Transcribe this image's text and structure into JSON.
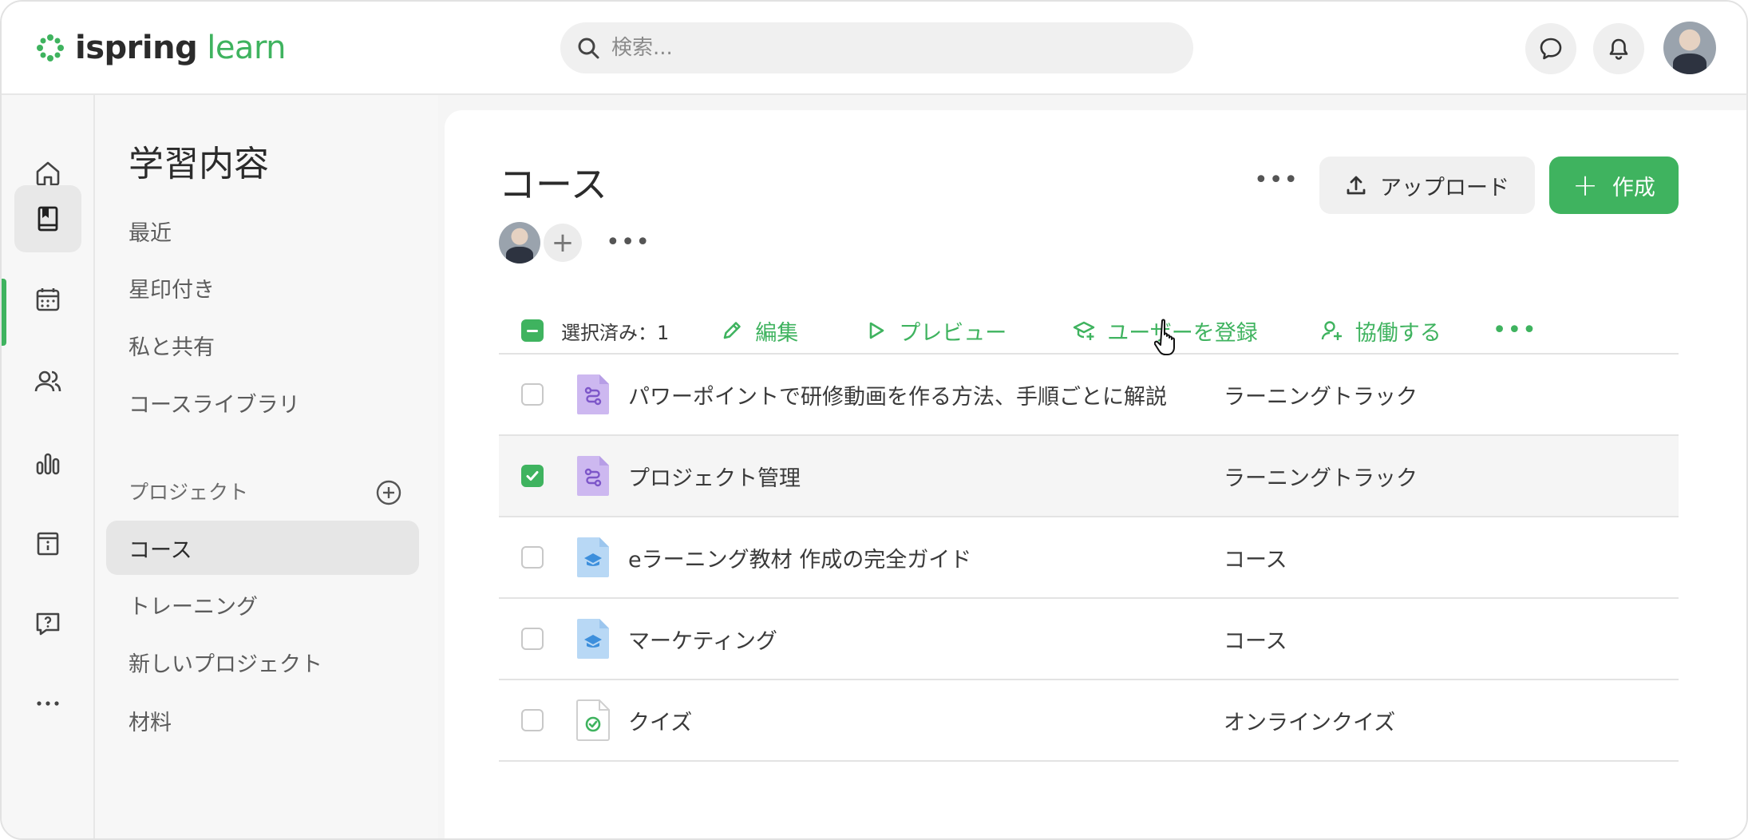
{
  "header": {
    "logo_primary": "ispring",
    "logo_secondary": "learn",
    "search_placeholder": "検索..."
  },
  "sidebar": {
    "title": "学習内容",
    "items": [
      {
        "label": "最近"
      },
      {
        "label": "星印付き"
      },
      {
        "label": "私と共有"
      },
      {
        "label": "コースライブラリ"
      }
    ],
    "section_label": "プロジェクト",
    "projects": [
      {
        "label": "コース",
        "active": true
      },
      {
        "label": "トレーニング"
      },
      {
        "label": "新しいプロジェクト"
      },
      {
        "label": "材料"
      }
    ]
  },
  "rail": {
    "icons": [
      "home-icon",
      "book-icon",
      "calendar-icon",
      "users-icon",
      "chart-icon",
      "info-board-icon",
      "help-icon",
      "more-icon"
    ],
    "active": "book-icon"
  },
  "main": {
    "title": "コース",
    "upload_label": "アップロード",
    "create_label": "作成",
    "more_dots": "•••"
  },
  "toolbar": {
    "selected_label": "選択済み：1",
    "edit_label": "編集",
    "preview_label": "プレビュー",
    "enroll_label": "ユーザーを登録",
    "collaborate_label": "協働する",
    "more_dots": "•••"
  },
  "rows": [
    {
      "title": "パワーポイントで研修動画を作る方法、手順ごとに解説",
      "type": "ラーニングトラック",
      "icon": "learning-track-icon",
      "checked": false
    },
    {
      "title": "プロジェクト管理",
      "type": "ラーニングトラック",
      "icon": "learning-track-icon",
      "checked": true
    },
    {
      "title": "eラーニング教材 作成の完全ガイド",
      "type": "コース",
      "icon": "course-icon",
      "checked": false
    },
    {
      "title": "マーケティング",
      "type": "コース",
      "icon": "course-icon",
      "checked": false
    },
    {
      "title": "クイズ",
      "type": "オンラインクイズ",
      "icon": "quiz-icon",
      "checked": false
    }
  ],
  "colors": {
    "accent": "#3fb35f",
    "track_icon": "#cdb8f0",
    "course_icon": "#b8d8f5"
  }
}
